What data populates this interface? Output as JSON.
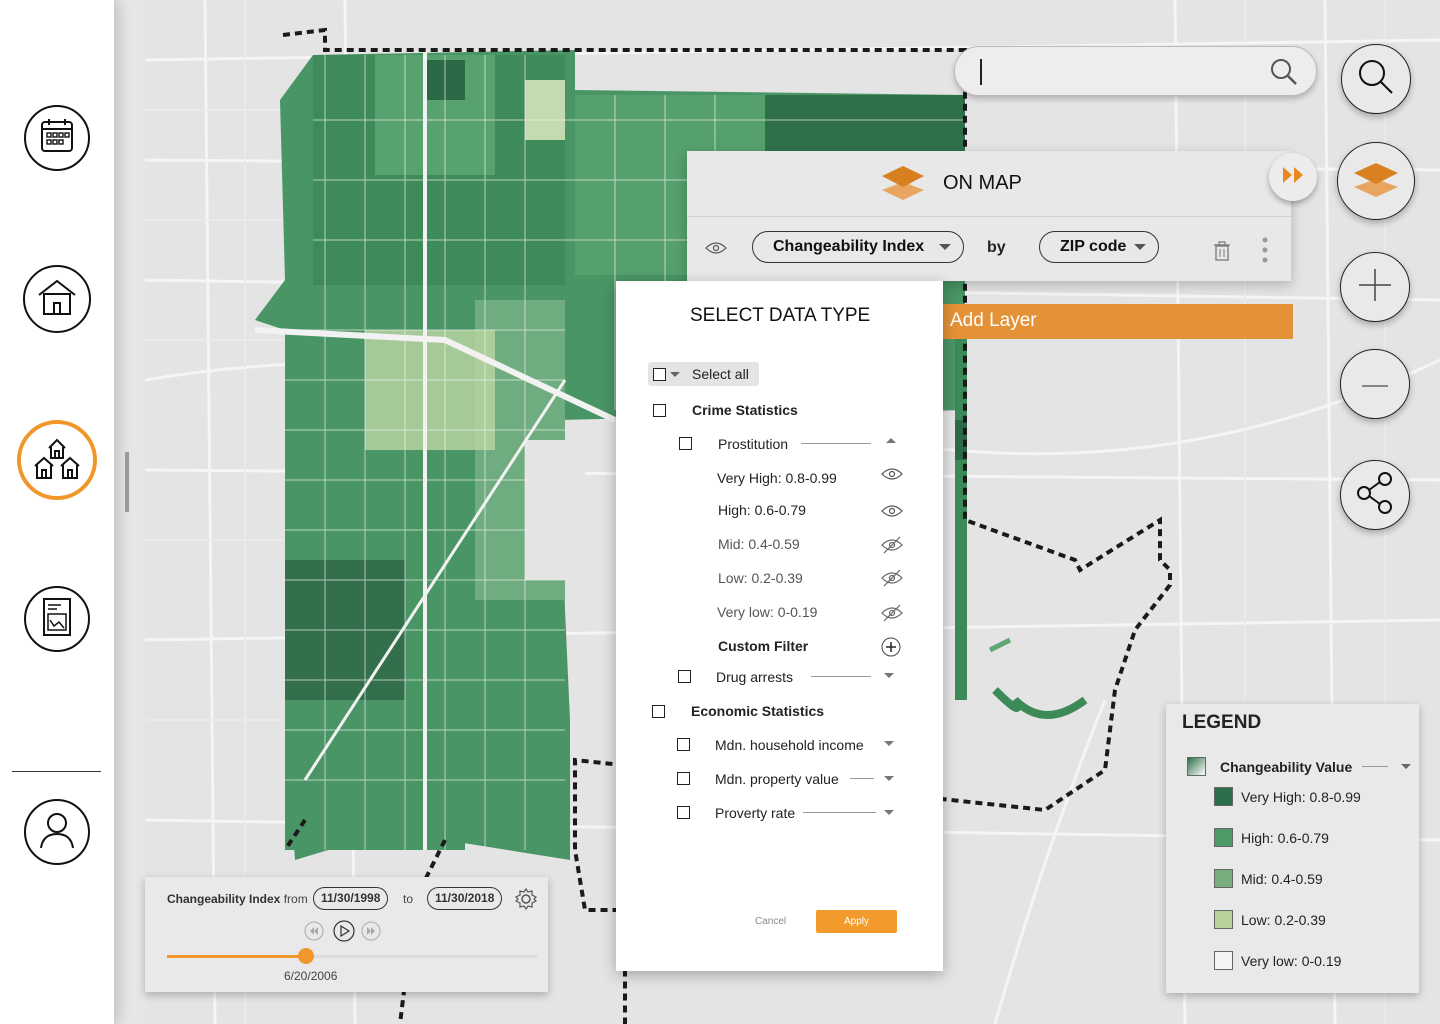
{
  "sidebar": {
    "items": [
      {
        "name": "calendar",
        "icon": "calendar-icon"
      },
      {
        "name": "home",
        "icon": "house-icon"
      },
      {
        "name": "neighborhood",
        "icon": "houses-icon",
        "active": true
      },
      {
        "name": "report",
        "icon": "report-chart-icon"
      },
      {
        "name": "profile",
        "icon": "user-icon"
      }
    ]
  },
  "search": {
    "placeholder": "",
    "value": ""
  },
  "on_map": {
    "title": "ON MAP",
    "layer": "Changeability Index",
    "by": "by",
    "group": "ZIP code",
    "add_layer": "Add Layer"
  },
  "data_type": {
    "title": "SELECT DATA TYPE",
    "select_all": "Select all",
    "crime": {
      "label": "Crime Statistics",
      "prostitution": "Prostitution",
      "levels": [
        "Very High: 0.8-0.99",
        "High: 0.6-0.79",
        "Mid: 0.4-0.59",
        "Low: 0.2-0.39",
        "Very low: 0-0.19"
      ],
      "custom_filter": "Custom Filter",
      "drug": "Drug arrests"
    },
    "economic": {
      "label": "Economic Statistics",
      "items": [
        "Mdn. household income",
        "Mdn. property value",
        "Proverty rate"
      ]
    },
    "cancel": "Cancel",
    "apply": "Apply"
  },
  "timeline": {
    "label": "Changeability Index",
    "from": "from",
    "start": "11/30/1998",
    "to": "to",
    "end": "11/30/2018",
    "current": "6/20/2006",
    "progress": 0.375
  },
  "legend": {
    "title": "LEGEND",
    "heading": "Changeability Value",
    "items": [
      {
        "label": "Very High: 0.8-0.99",
        "color": "#2d6e4a"
      },
      {
        "label": "High: 0.6-0.79",
        "color": "#4f9a68"
      },
      {
        "label": "Mid: 0.4-0.59",
        "color": "#78ad7e"
      },
      {
        "label": "Low: 0.2-0.39",
        "color": "#b8d39a"
      },
      {
        "label": "Very low: 0-0.19",
        "color": "#f4f4f4"
      }
    ]
  },
  "colors": {
    "accent": "#f0962a",
    "map_base": "#e4e4e4"
  }
}
